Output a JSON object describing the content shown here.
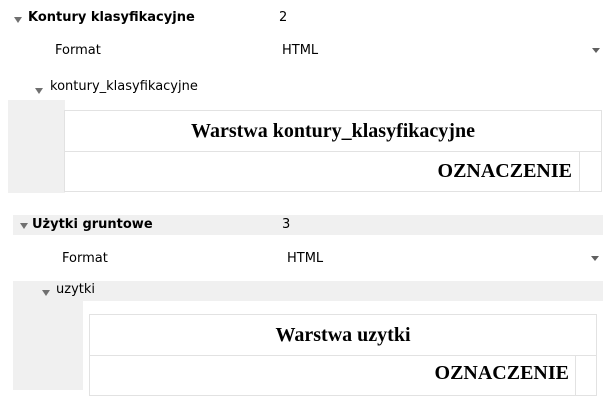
{
  "section1": {
    "title": "Kontury klasyfikacyjne",
    "count": "2",
    "format_label": "Format",
    "format_value": "HTML",
    "layer_node": "kontury_klasyfikacyjne",
    "table_title": "Warstwa kontury_klasyfikacyjne",
    "column_header": "OZNACZENIE"
  },
  "section2": {
    "title": "Użytki gruntowe",
    "count": "3",
    "format_label": "Format",
    "format_value": "HTML",
    "layer_node": "uzytki",
    "table_title": "Warstwa uzytki",
    "column_header": "OZNACZENIE"
  },
  "icons": {
    "expand": "chevron-down-icon",
    "dropdown": "dropdown-arrow-icon"
  }
}
